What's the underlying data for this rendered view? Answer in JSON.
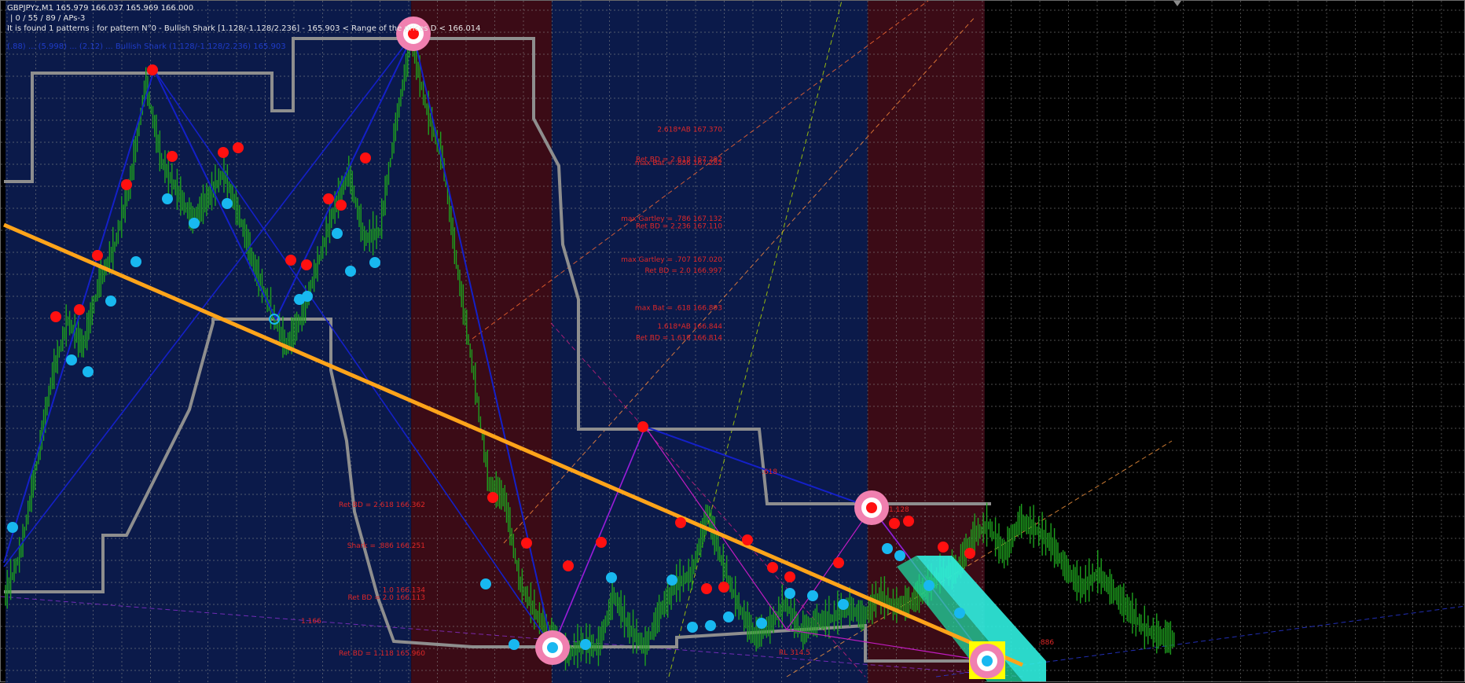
{
  "window": {
    "title": "GBPJPYz,M1  165.979 166.037 165.969 166.000",
    "stats": "| 0 / 55 / 89 / APs-3",
    "info": "It is found 1 patterns :  for pattern N°0 - Bullish Shark [1.128/-1.128/2.236] - 165.903 < Range of the prices D < 166.014",
    "overlay": "(.88) ... (5.998) ... (2.12) ... Bullish Shark (1.128/-1.128/2.236) 165.903"
  },
  "colors": {
    "background": "#000000",
    "blue_zone": "#0b1a4a",
    "red_zone": "#3b0b16",
    "grid": "#8a8a8a",
    "candle": "#1ea01e",
    "trendline": "#ffa41a",
    "pattern_lines": "#1420c8",
    "magenta_lines": "#c01cc0",
    "stepline": "#8e8e8e",
    "peak_dot": "#ff1010",
    "trough_dot": "#18b8f0",
    "target_ring": "#f080b0",
    "highlight_box": "#ffff00",
    "channel": "#30f0e0"
  },
  "chart_data": {
    "type": "line",
    "symbol": "GBPJPYz",
    "timeframe": "M1",
    "ohlc_last": {
      "open": 165.979,
      "high": 166.037,
      "low": 165.969,
      "close": 166.0
    },
    "pattern": {
      "name": "Bullish Shark",
      "ratios": [
        1.128,
        -1.128,
        2.236
      ],
      "d_range": [
        165.903,
        166.014
      ],
      "found_count": 1
    },
    "x": [
      0,
      20,
      40,
      60,
      80,
      100,
      120,
      140,
      160,
      180,
      200,
      220,
      240,
      260,
      280,
      300,
      320,
      340,
      360,
      380,
      400,
      420,
      440,
      460,
      480,
      500,
      520,
      540,
      560,
      580,
      600,
      620,
      640,
      660,
      680,
      700,
      720,
      740,
      760,
      780,
      800,
      820,
      840,
      860,
      880,
      900,
      920,
      940,
      960,
      980,
      1000,
      1020,
      1040,
      1060,
      1080,
      1100,
      1120,
      1140,
      1160,
      1180,
      1200,
      1220,
      1240,
      1260,
      1280,
      1300,
      1320,
      1340,
      1360,
      1380,
      1400,
      1420,
      1440,
      1460,
      1480,
      1500
    ],
    "series": [
      {
        "values": [
          166.12,
          166.24,
          166.47,
          166.71,
          166.86,
          166.79,
          166.96,
          167.06,
          167.23,
          167.5,
          167.29,
          167.21,
          167.13,
          167.19,
          167.26,
          167.14,
          167.0,
          166.89,
          166.79,
          166.87,
          167.01,
          167.15,
          167.26,
          167.08,
          167.1,
          167.38,
          167.62,
          167.43,
          167.3,
          166.99,
          166.72,
          166.42,
          166.38,
          166.15,
          166.07,
          166.01,
          165.96,
          165.99,
          165.98,
          166.12,
          166.03,
          165.98,
          166.08,
          166.15,
          166.18,
          166.34,
          166.2,
          166.09,
          166.01,
          166.04,
          166.1,
          166.02,
          166.05,
          166.06,
          166.09,
          166.06,
          166.12,
          166.09,
          166.1,
          166.14,
          166.18,
          166.19,
          166.28,
          166.31,
          166.23,
          166.32,
          166.3,
          166.26,
          166.19,
          166.14,
          166.18,
          166.13,
          166.08,
          166.03,
          166.01,
          166.0
        ]
      }
    ],
    "y_range": [
      165.89,
      167.71
    ],
    "zones": [
      {
        "type": "blue",
        "from": 0,
        "to": 520
      },
      {
        "type": "red",
        "from": 520,
        "to": 700
      },
      {
        "type": "blue",
        "from": 700,
        "to": 1105
      },
      {
        "type": "red",
        "from": 1105,
        "to": 1255
      }
    ],
    "level_labels": [
      {
        "text": "2.618*AB  167.370",
        "price": 167.37
      },
      {
        "text": "Ret BD = 2.618  167.292",
        "price": 167.29
      },
      {
        "text": "max Bat = .886  167.282",
        "price": 167.28
      },
      {
        "text": "max Gartley = .786  167.132",
        "price": 167.13
      },
      {
        "text": "Ret BD = 2.236  167.110",
        "price": 167.11
      },
      {
        "text": "max Gartley = .707  167.020",
        "price": 167.02
      },
      {
        "text": "Ret BD = 2.0  166.997",
        "price": 166.99
      },
      {
        "text": "max Bat = .618  166.893",
        "price": 166.89
      },
      {
        "text": "1.618*AB  166.844",
        "price": 166.84
      },
      {
        "text": "Ret BD = 1.618  166.814",
        "price": 166.81
      },
      {
        "text": "Ret BD = 2.618  166.362",
        "price": 166.36
      },
      {
        "text": "Shark = .886  166.251",
        "price": 166.25
      },
      {
        "text": "1.0  166.134",
        "price": 166.13
      },
      {
        "text": "Ret BD = 2.0  166.113",
        "price": 166.11
      },
      {
        "text": "Ret BD = 1.118  165.960",
        "price": 165.96
      }
    ],
    "misc_labels": [
      ".618",
      "1.128",
      ".886",
      "1.166",
      "RL 314.5"
    ],
    "grid": true,
    "legend": "none"
  }
}
